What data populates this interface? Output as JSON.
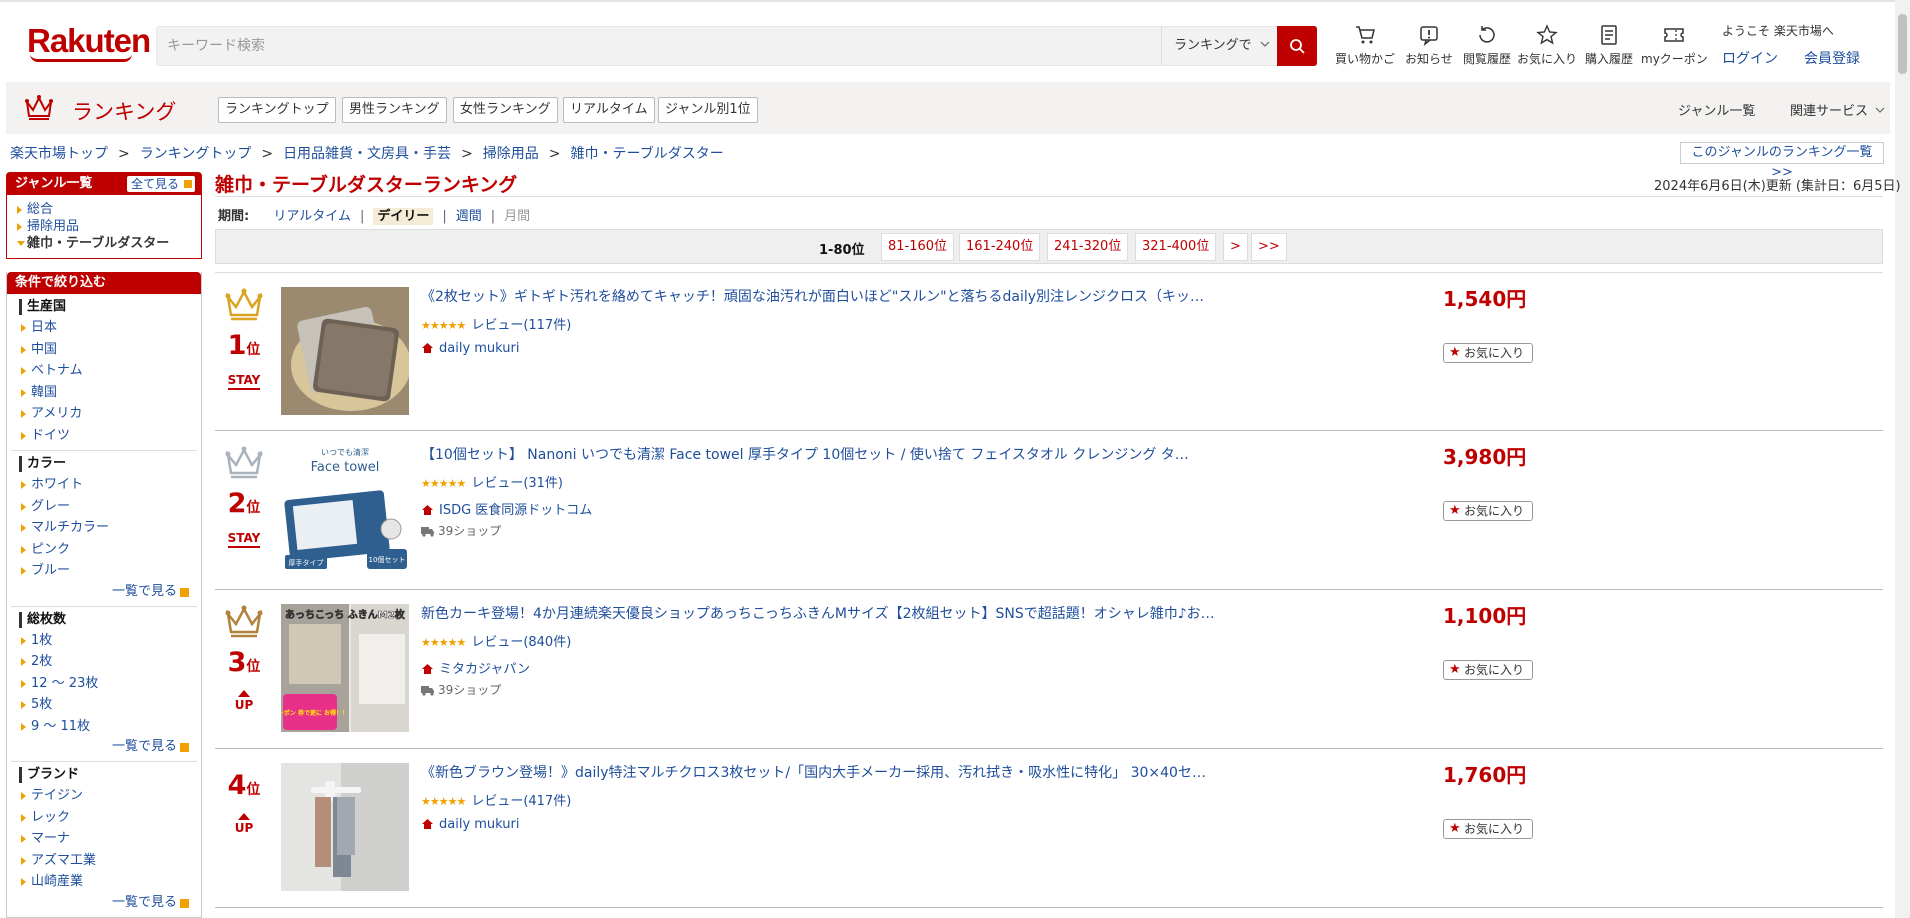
{
  "header": {
    "logo": "Rakuten",
    "search_placeholder": "キーワード検索",
    "search_scope": "ランキングで",
    "icons": [
      {
        "name": "cart-icon",
        "label": "買い物かご"
      },
      {
        "name": "notice-icon",
        "label": "お知らせ"
      },
      {
        "name": "history-icon",
        "label": "閲覧履歴"
      },
      {
        "name": "star-icon",
        "label": "お気に入り"
      },
      {
        "name": "purchase-history-icon",
        "label": "購入履歴"
      },
      {
        "name": "coupon-icon",
        "label": "myクーポン"
      }
    ],
    "welcome": "ようこそ 楽天市場へ",
    "login": "ログイン",
    "signup": "会員登録"
  },
  "ranking_bar": {
    "title": "ランキング",
    "tabs": [
      "ランキングトップ",
      "男性ランキング",
      "女性ランキング",
      "リアルタイム",
      "ジャンル別1位"
    ],
    "genre_list": "ジャンル一覧",
    "related": "関連サービス"
  },
  "breadcrumb": [
    "楽天市場トップ",
    "ランキングトップ",
    "日用品雑貨・文房具・手芸",
    "掃除用品",
    "雑巾・テーブルダスター"
  ],
  "genre_ranking_link": "このジャンルのランキング一覧 >>",
  "sidebar": {
    "genre_title": "ジャンル一覧",
    "all_label": "全て見る",
    "genres": [
      "総合",
      "掃除用品",
      "雑巾・テーブルダスター"
    ],
    "filter_title": "条件で絞り込む",
    "more_label": "一覧で見る",
    "filters": [
      {
        "title": "生産国",
        "items": [
          "日本",
          "中国",
          "ベトナム",
          "韓国",
          "アメリカ",
          "ドイツ"
        ]
      },
      {
        "title": "カラー",
        "items": [
          "ホワイト",
          "グレー",
          "マルチカラー",
          "ピンク",
          "ブルー"
        ]
      },
      {
        "title": "総枚数",
        "items": [
          "1枚",
          "2枚",
          "12 ～ 23枚",
          "5枚",
          "9 ～ 11枚"
        ]
      },
      {
        "title": "ブランド",
        "items": [
          "テイジン",
          "レック",
          "マーナ",
          "アズマ工業",
          "山崎産業"
        ]
      }
    ]
  },
  "main": {
    "title": "雑巾・テーブルダスターランキング",
    "updated": "2024年6月6日(木)更新 (集計日：6月5日)",
    "period_label": "期間:",
    "periods": [
      "リアルタイム",
      "デイリー",
      "週間",
      "月間"
    ],
    "pager_current": "1-80位",
    "pages": [
      "81-160位",
      "161-240位",
      "241-320位",
      "321-400位",
      ">",
      ">>"
    ],
    "rank_suffix": "位",
    "fav_label": "お気に入り",
    "items": [
      {
        "rank": "1",
        "trend": "STAY",
        "name": "《2枚セット》ギトギト汚れを絡めてキャッチ！頑固な油汚れが面白いほど\"スルン\"と落ちるdaily別注レンジクロス（キッ…",
        "stars": "★★★★★",
        "review": "レビュー(117件)",
        "shop": "daily mukuri",
        "shops": "",
        "price": "1,540円"
      },
      {
        "rank": "2",
        "trend": "STAY",
        "name": "【10個セット】 Nanoni いつでも清潔 Face towel 厚手タイプ 10個セット / 使い捨て フェイスタオル クレンジング タ…",
        "stars": "★★★★★",
        "review": "レビュー(31件)",
        "shop": "ISDG 医食同源ドットコム",
        "shops": "39ショップ",
        "price": "3,980円"
      },
      {
        "rank": "3",
        "trend": "UP",
        "name": "新色カーキ登場！4か月連続楽天優良ショップあっちこっちふきんMサイズ【2枚組セット】SNSで超話題！オシャレ雑巾♪お…",
        "stars": "★★★★★",
        "review": "レビュー(840件)",
        "shop": "ミタカジャパン",
        "shops": "39ショップ",
        "price": "1,100円"
      },
      {
        "rank": "4",
        "trend": "UP",
        "name": "《新色ブラウン登場！》daily特注マルチクロス3枚セット/「国内大手メーカー採用、汚れ拭き・吸水性に特化」 30×40セ…",
        "stars": "★★★★★",
        "review": "レビュー(417件)",
        "shop": "daily mukuri",
        "shops": "",
        "price": "1,760円"
      }
    ],
    "thumb2_text": {
      "top": "いつでも清潔",
      "title": "Face towel",
      "badge": "厚手タイプ",
      "count": "10個セット"
    },
    "thumb3_text": {
      "title": "あっちこっち ふきんM2枚",
      "coupon": "クーポン 券で更に お得！！"
    }
  }
}
